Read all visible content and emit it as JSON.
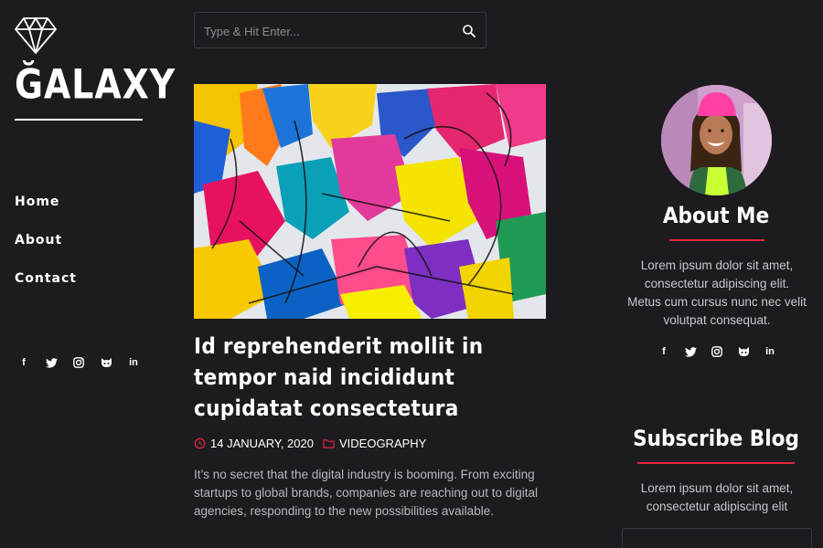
{
  "brand": {
    "name": "ĞALAXY",
    "icon": "diamond-icon"
  },
  "nav": {
    "items": [
      "Home",
      "About",
      "Contact"
    ]
  },
  "social": {
    "icons": [
      "facebook-icon",
      "twitter-icon",
      "instagram-icon",
      "github-icon",
      "linkedin-icon"
    ],
    "glyphs": [
      "f",
      "🐦",
      "◎",
      "◉",
      "in"
    ]
  },
  "search": {
    "placeholder": "Type & Hit Enter...",
    "value": "",
    "icon": "search-icon"
  },
  "post": {
    "title": "Id reprehenderit mollit in tempor naid incididunt cupidatat consectetura",
    "date": "14 JANUARY, 2020",
    "category": "VIDEOGRAPHY",
    "excerpt": "It’s no secret that the digital industry is booming. From exciting startups to global brands, companies are reaching out to digital agencies, responding to the new possibilities available."
  },
  "about": {
    "title": "About Me",
    "text": "Lorem ipsum dolor sit amet, consectetur adipiscing elit. Metus cum cursus nunc nec velit volutpat consequat."
  },
  "subscribe": {
    "title": "Subscribe Blog",
    "text": "Lorem ipsum dolor sit amet, consectetur adipiscing elit"
  },
  "colors": {
    "background": "#1c1b20",
    "accent": "#e0243b",
    "text": "#ffffff",
    "muted": "#b9b8bd"
  }
}
